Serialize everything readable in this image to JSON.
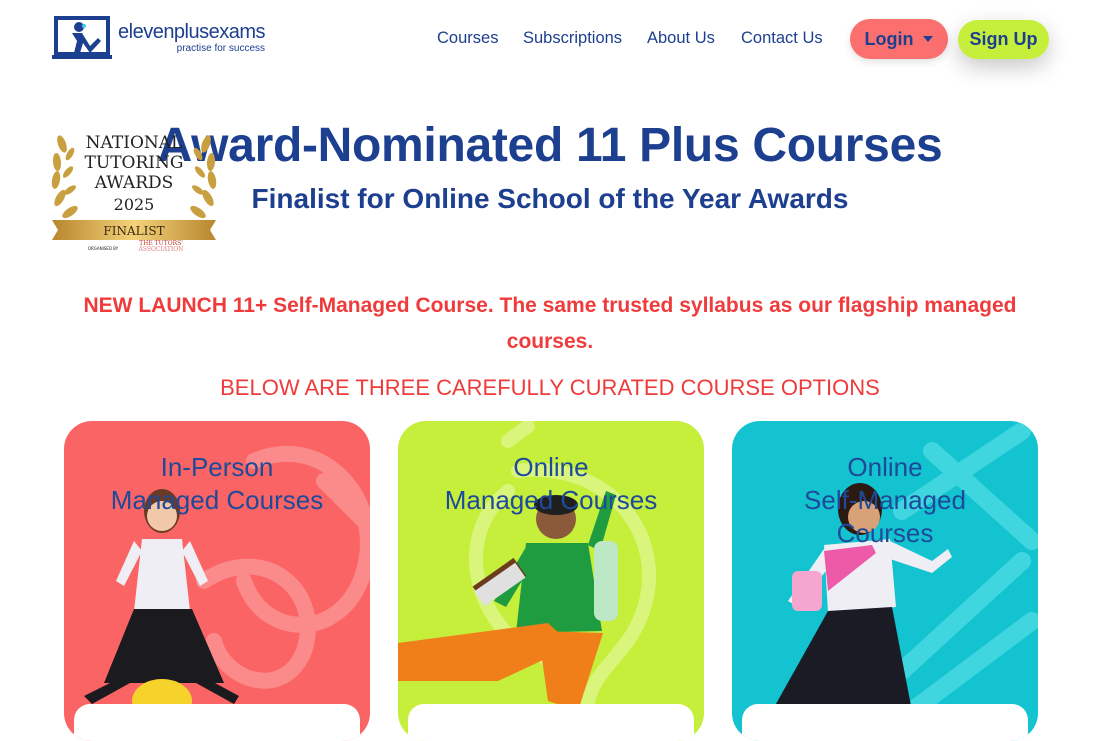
{
  "brand": {
    "name": "elevenplusexams",
    "tagline": "practise for success",
    "icon": "student-at-desk-icon",
    "color": "#1d3f8f"
  },
  "nav": {
    "items": [
      "Courses",
      "Subscriptions",
      "About Us",
      "Contact Us"
    ],
    "login_label": "Login",
    "signup_label": "Sign Up",
    "login_color": "#fb6f6f",
    "signup_color": "#c6ef3c"
  },
  "badge": {
    "line1": "NATIONAL",
    "line2": "TUTORING",
    "line3": "AWARDS",
    "year": "2025",
    "ribbon": "FINALIST",
    "organiser_prefix": "ORGANISED BY",
    "organiser_line1": "THE TUTORS'",
    "organiser_line2": "ASSOCIATION"
  },
  "hero": {
    "title": "Award-Nominated 11 Plus Courses",
    "subtitle": "Finalist for Online School of the Year Awards"
  },
  "announcement": {
    "text": "NEW LAUNCH 11+ Self-Managed Course. The same trusted syllabus as our flagship managed courses.",
    "color": "#ef3b3b"
  },
  "options_heading": "BELOW ARE THREE CAREFULLY CURATED COURSE OPTIONS",
  "cards": [
    {
      "line1": "In-Person",
      "line2": "Managed Courses",
      "line3": "",
      "color": "#fb6464"
    },
    {
      "line1": "Online",
      "line2": "Managed Courses",
      "line3": "",
      "color": "#c6ef3c"
    },
    {
      "line1": "Online",
      "line2": "Self-Managed",
      "line3": "Courses",
      "color": "#13c3cf"
    }
  ]
}
